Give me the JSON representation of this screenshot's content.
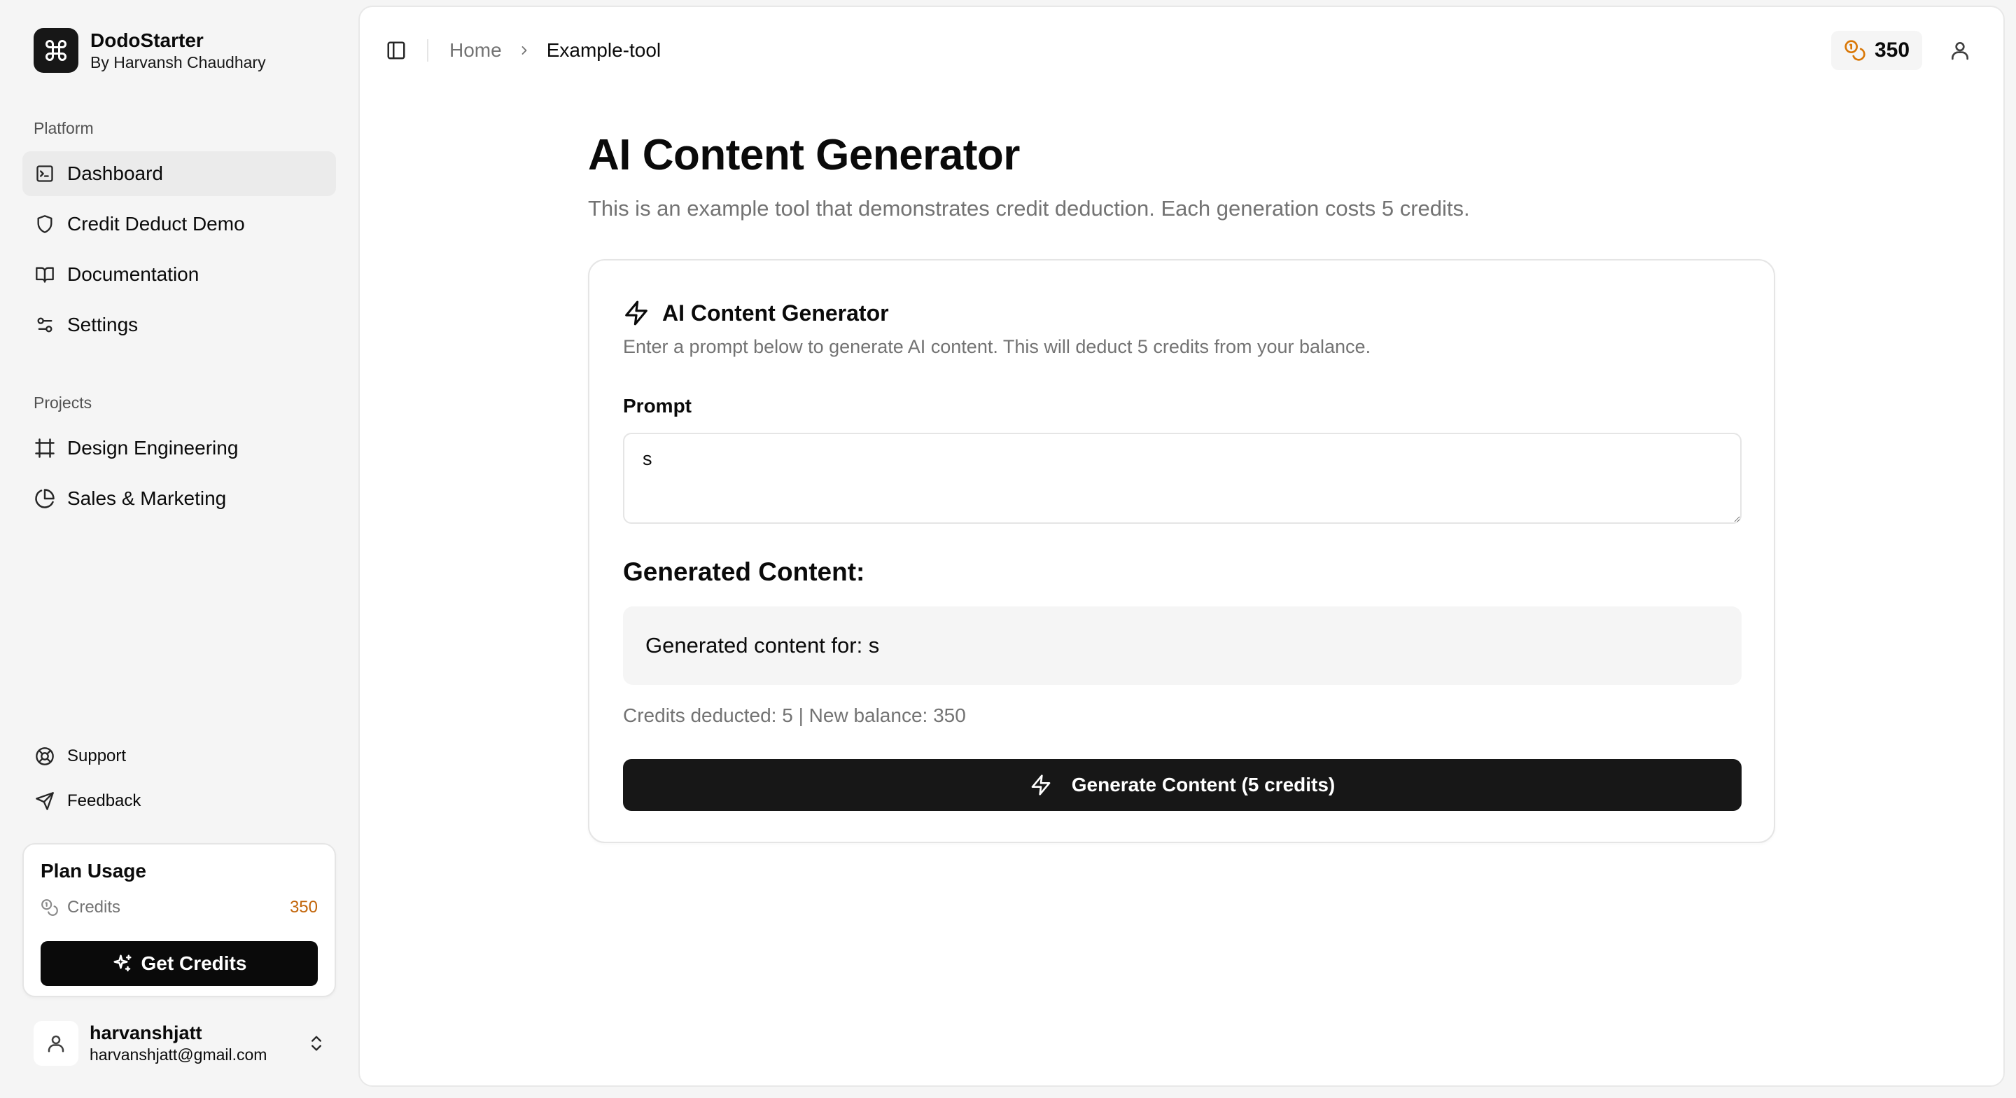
{
  "app": {
    "name": "DodoStarter",
    "byline": "By Harvansh Chaudhary",
    "logo_icon": "command-icon"
  },
  "sidebar": {
    "platform_label": "Platform",
    "platform_items": [
      {
        "label": "Dashboard",
        "icon": "dashboard-icon",
        "active": true
      },
      {
        "label": "Credit Deduct Demo",
        "icon": "shield-icon",
        "active": false
      },
      {
        "label": "Documentation",
        "icon": "book-icon",
        "active": false
      },
      {
        "label": "Settings",
        "icon": "sliders-icon",
        "active": false
      }
    ],
    "projects_label": "Projects",
    "project_items": [
      {
        "label": "Design Engineering",
        "icon": "frame-icon"
      },
      {
        "label": "Sales & Marketing",
        "icon": "pie-chart-icon"
      }
    ],
    "secondary_items": [
      {
        "label": "Support",
        "icon": "life-buoy-icon"
      },
      {
        "label": "Feedback",
        "icon": "send-icon"
      }
    ],
    "plan": {
      "title": "Plan Usage",
      "credits_label": "Credits",
      "credits_value": "350",
      "button_label": "Get Credits"
    },
    "user": {
      "name": "harvanshjatt",
      "email": "harvanshjatt@gmail.com"
    }
  },
  "header": {
    "breadcrumb_home": "Home",
    "breadcrumb_current": "Example-tool",
    "credits": "350"
  },
  "page": {
    "title": "AI Content Generator",
    "description": "This is an example tool that demonstrates credit deduction. Each generation costs 5 credits."
  },
  "tool": {
    "title": "AI Content Generator",
    "description": "Enter a prompt below to generate AI content. This will deduct 5 credits from your balance.",
    "prompt_label": "Prompt",
    "prompt_value": "s",
    "generated_heading": "Generated Content:",
    "generated_text": "Generated content for: s",
    "meta": "Credits deducted: 5 | New balance: 350",
    "button_label": "Generate Content (5 credits)"
  },
  "colors": {
    "accent_credit": "#c2650a",
    "primary_button": "#171717"
  }
}
